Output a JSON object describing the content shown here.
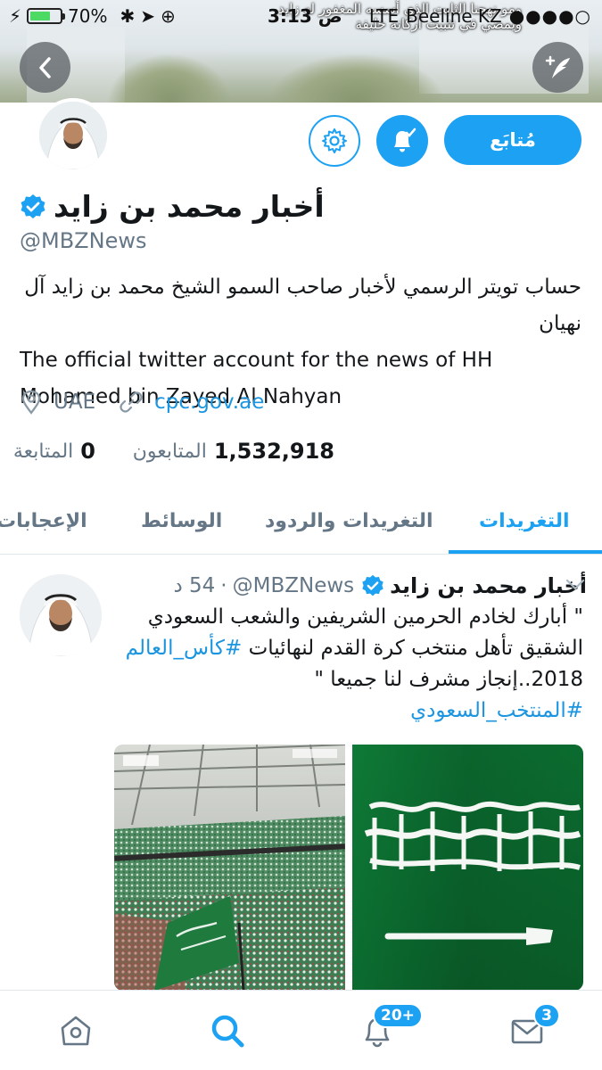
{
  "status_bar": {
    "battery": "70%",
    "battery_level": 0.7,
    "time": "3:13",
    "time_suffix": "ص",
    "carrier": "Beeline KZ",
    "network": "LTE",
    "overlay_line1": "ومو نهجنا الثابت الذي أسسه المغفور له زايد",
    "overlay_line2": "ويمضي في تثبيت أركانه خليفة"
  },
  "header": {
    "back_icon": "chevron-left-icon",
    "compose_icon": "feather-plus-icon"
  },
  "profile": {
    "follow_label": "مُتابَع",
    "name": "أخبار محمد بن زايد",
    "handle": "@MBZNews",
    "bio_ar": "حساب تويتر الرسمي لأخبار صاحب السمو الشيخ محمد بن زايد آل نهيان",
    "bio_en": "The official twitter account for the news of HH Mohamed bin Zayed Al Nahyan",
    "location": "UAE",
    "website": "cpc.gov.ae",
    "following_count": "0",
    "following_label": "المتابعة",
    "followers_count": "1,532,918",
    "followers_label": "المتابعون"
  },
  "tabs": [
    {
      "label": "التغريدات",
      "active": true
    },
    {
      "label": "التغريدات والردود",
      "active": false
    },
    {
      "label": "الوسائط",
      "active": false
    },
    {
      "label": "الإعجابات",
      "active": false
    }
  ],
  "tweet": {
    "name": "أخبار محمد بن زايد",
    "handle": "@MBZNews",
    "time": "54 د",
    "separator": "·",
    "text_part1": "\" أبارك لخادم الحرمين الشريفين والشعب السعودي الشقيق تأهل منتخب كرة القدم لنهائيات",
    "hashtag1": "#كأس_العالم",
    "text_part2": "2018..إنجاز مشرف لنا جميعا \"",
    "hashtag2": "#المنتخب_السعودي"
  },
  "bottom_nav": {
    "notifications_badge": "20+",
    "messages_badge": "3"
  },
  "colors": {
    "accent": "#1da1f2",
    "link": "#1b95e0",
    "secondary_text": "#657786",
    "flag_green": "#0b6b2f"
  }
}
